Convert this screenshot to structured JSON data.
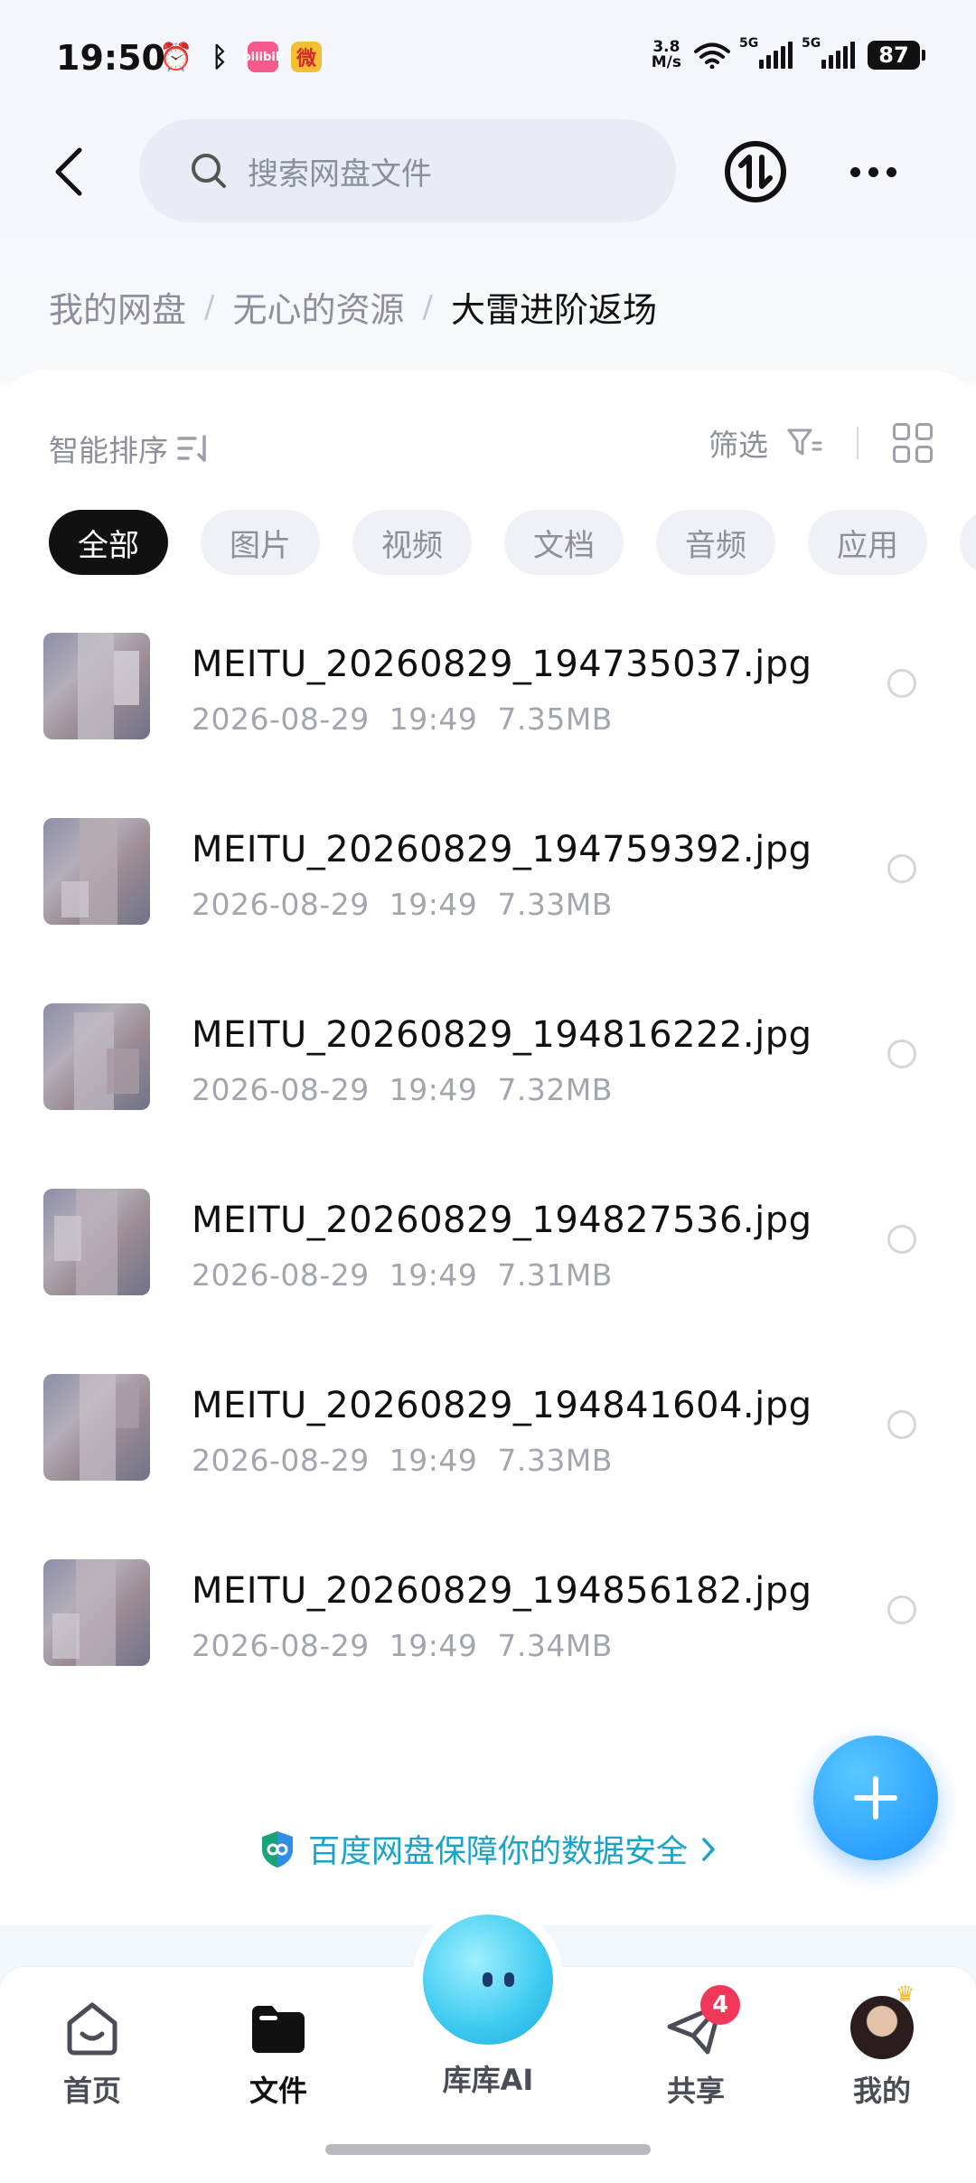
{
  "status_bar": {
    "time": "19:50",
    "net_speed_value": "3.8",
    "net_speed_unit": "M/s",
    "signal1_label": "5G",
    "signal2_label": "5G",
    "battery": "87",
    "left_icons": [
      "alarm-icon",
      "bluetooth-icon",
      "bilibili-icon",
      "weibo-icon"
    ],
    "bilibili_text": "bilibili",
    "weibo_text": "微"
  },
  "header": {
    "search_placeholder": "搜索网盘文件"
  },
  "breadcrumb": {
    "items": [
      "我的网盘",
      "无心的资源",
      "大雷进阶返场"
    ],
    "separator": "/"
  },
  "toolbar": {
    "sort_label": "智能排序",
    "filter_label": "筛选"
  },
  "chips": [
    {
      "label": "全部",
      "active": true
    },
    {
      "label": "图片",
      "active": false
    },
    {
      "label": "视频",
      "active": false
    },
    {
      "label": "文档",
      "active": false
    },
    {
      "label": "音频",
      "active": false
    },
    {
      "label": "应用",
      "active": false
    }
  ],
  "files": [
    {
      "name": "MEITU_20260829_194735037.jpg",
      "date": "2026-08-29",
      "time": "19:49",
      "size": "7.35MB"
    },
    {
      "name": "MEITU_20260829_194759392.jpg",
      "date": "2026-08-29",
      "time": "19:49",
      "size": "7.33MB"
    },
    {
      "name": "MEITU_20260829_194816222.jpg",
      "date": "2026-08-29",
      "time": "19:49",
      "size": "7.32MB"
    },
    {
      "name": "MEITU_20260829_194827536.jpg",
      "date": "2026-08-29",
      "time": "19:49",
      "size": "7.31MB"
    },
    {
      "name": "MEITU_20260829_194841604.jpg",
      "date": "2026-08-29",
      "time": "19:49",
      "size": "7.33MB"
    },
    {
      "name": "MEITU_20260829_194856182.jpg",
      "date": "2026-08-29",
      "time": "19:49",
      "size": "7.34MB"
    }
  ],
  "security_text": "百度网盘保障你的数据安全",
  "bottom_nav": {
    "home": "首页",
    "files": "文件",
    "ai": "库库AI",
    "share": "共享",
    "share_badge": "4",
    "me": "我的"
  },
  "colors": {
    "accent_blue": "#1a8fff",
    "security_teal": "#1aa3c4",
    "badge_red": "#f2385a",
    "chip_active_bg": "#111111"
  }
}
